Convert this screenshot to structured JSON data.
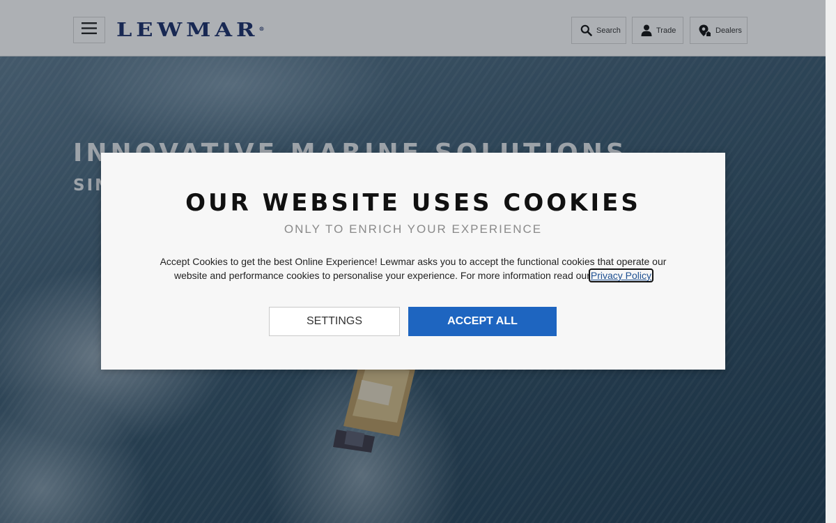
{
  "header": {
    "logo_text": "LEWMAR",
    "logo_mark": "®",
    "menu_icon": "hamburger-icon",
    "search_label": "Search",
    "trade_label": "Trade",
    "dealers_label": "Dealers",
    "colors": {
      "logo": "#1b2f6a",
      "background": "#ffffff"
    }
  },
  "hero": {
    "headline": "INNOVATIVE MARINE SOLUTIONS",
    "subheadline": "SIN"
  },
  "cookie_modal": {
    "title": "OUR WEBSITE USES COOKIES",
    "subtitle": "ONLY TO ENRICH YOUR EXPERIENCE",
    "body": "Accept Cookies to get the best Online Experience! Lewmar asks you to accept the functional cookies that operate our website and performance cookies to personalise your experience. For more information read our",
    "link_label": "Privacy Policy",
    "settings_label": "SETTINGS",
    "accept_label": "ACCEPT ALL",
    "colors": {
      "accept_button": "#1e65c0",
      "link": "#1d4f91"
    }
  }
}
